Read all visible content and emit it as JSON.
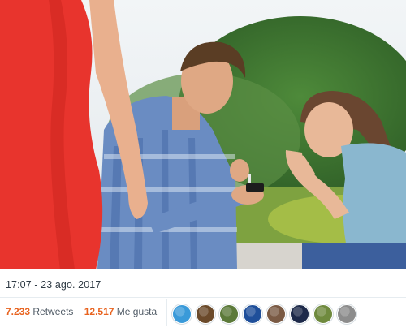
{
  "tweet": {
    "timestamp": "17:07 - 23 ago. 2017",
    "retweets": {
      "count": "7.233",
      "label": "Retweets"
    },
    "likes": {
      "count": "12.517",
      "label": "Me gusta"
    },
    "accent_color": "#e8631f"
  },
  "media": {
    "type": "photo",
    "subject": "distracted-boyfriend"
  },
  "likers": [
    {
      "icon": "globe-avatar",
      "color": "#3a9ad9"
    },
    {
      "icon": "person-avatar",
      "color": "#6b4a2a"
    },
    {
      "icon": "landscape-avatar",
      "color": "#5c7a3a"
    },
    {
      "icon": "earth-avatar",
      "color": "#1f4f9a"
    },
    {
      "icon": "face-avatar",
      "color": "#7a5a44"
    },
    {
      "icon": "dark-avatar",
      "color": "#1d2a4a"
    },
    {
      "icon": "scenery-avatar",
      "color": "#6f8a3e"
    },
    {
      "icon": "portrait-avatar",
      "color": "#8c8c8c"
    }
  ]
}
